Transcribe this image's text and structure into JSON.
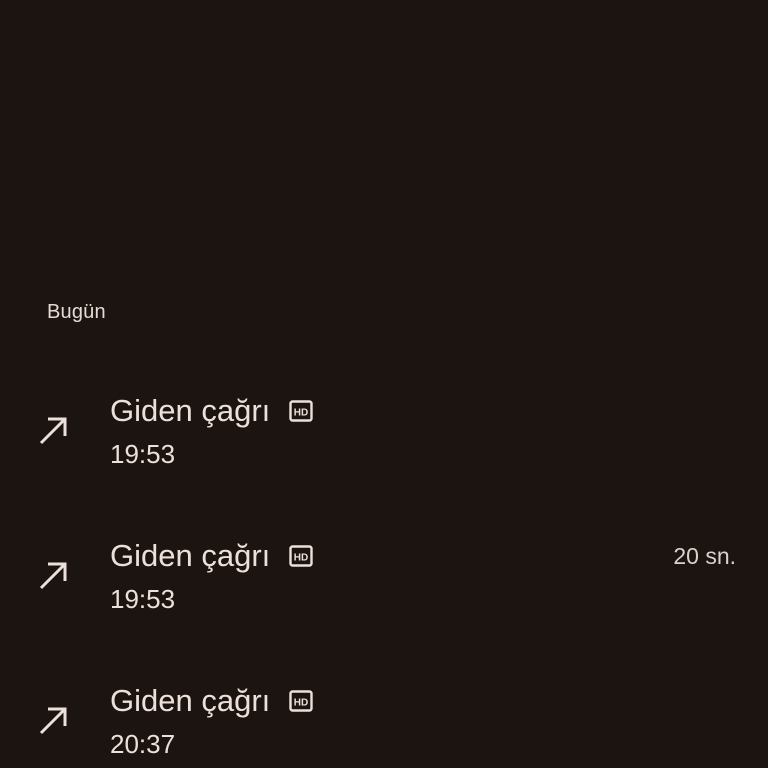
{
  "section": {
    "title": "Bugün"
  },
  "calls": [
    {
      "type": "Giden çağrı",
      "time": "19:53",
      "duration": "",
      "direction_icon": "outgoing-call-arrow-icon",
      "badge_icon": "hd-icon"
    },
    {
      "type": "Giden çağrı",
      "time": "19:53",
      "duration": "20 sn.",
      "direction_icon": "outgoing-call-arrow-icon",
      "badge_icon": "hd-icon"
    },
    {
      "type": "Giden çağrı",
      "time": "20:37",
      "duration": "",
      "direction_icon": "outgoing-call-arrow-icon",
      "badge_icon": "hd-icon"
    }
  ],
  "colors": {
    "background": "#1b1411",
    "text": "#ece0d9"
  }
}
